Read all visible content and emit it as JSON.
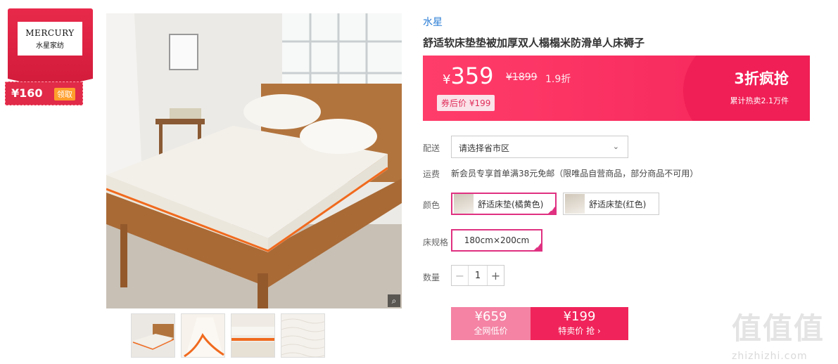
{
  "brand_card": {
    "logo_en": "MERCURY",
    "logo_cn": "水星家纺",
    "coupon_amount": "¥160",
    "coupon_action": "领取"
  },
  "product": {
    "brand": "水星",
    "title": "舒适软床垫垫被加厚双人榻榻米防滑单人床褥子",
    "price_symbol": "¥",
    "price": "359",
    "original_price": "¥1899",
    "discount": "1.9折",
    "after_coupon": "券后价 ¥199",
    "promo_title": "3折疯抢",
    "promo_sub": "累计热卖2.1万件"
  },
  "options": {
    "delivery_label": "配送",
    "delivery_placeholder": "请选择省市区",
    "shipping_label": "运费",
    "shipping_text": "新会员专享首单满38元免邮（限唯品自营商品，部分商品不可用）",
    "color_label": "颜色",
    "colors": [
      {
        "label": "舒适床垫(橘黄色)",
        "selected": true
      },
      {
        "label": "舒适床垫(红色)",
        "selected": false
      }
    ],
    "size_label": "床规格",
    "sizes": [
      {
        "label": "180cm×200cm",
        "selected": true
      }
    ],
    "quantity_label": "数量",
    "quantity": "1",
    "minus": "−",
    "plus": "+"
  },
  "buy_bar": {
    "left_price": "¥659",
    "left_caption": "全网低价",
    "right_price": "¥199",
    "right_caption": "特卖价 抢 ›"
  },
  "watermark": {
    "text": "值值值",
    "site": "zhizhizhi.com"
  },
  "icons": {
    "zoom": "search-icon",
    "chevron": "chevron-down-icon",
    "check": "check-icon"
  },
  "colors": {
    "accent_pink": "#f0245a",
    "brand_red": "#e02a48",
    "link_blue": "#2a7dd6",
    "select_border": "#e03181"
  }
}
